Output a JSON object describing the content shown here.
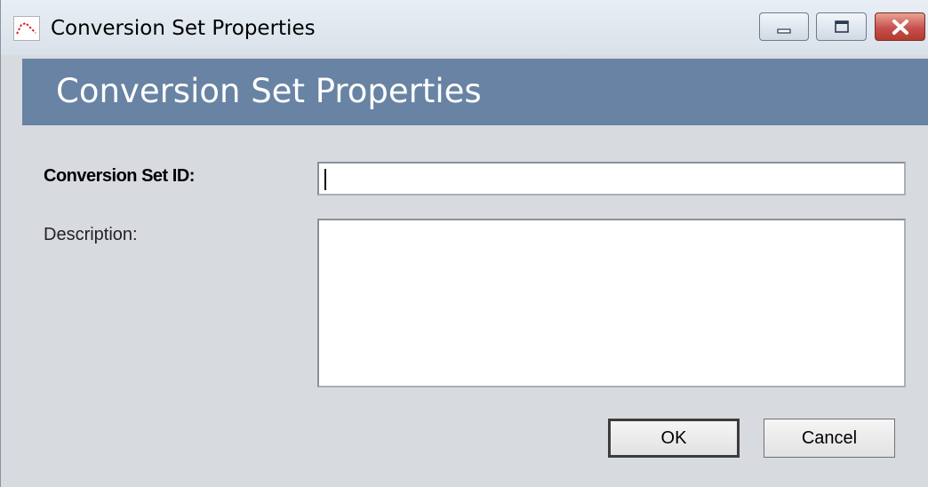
{
  "window": {
    "title": "Conversion Set Properties",
    "controls": {
      "minimize_icon": "minimize-icon",
      "maximize_icon": "maximize-icon",
      "close_icon": "close-icon"
    }
  },
  "header": {
    "title": "Conversion Set Properties",
    "background_color": "#6883a3"
  },
  "form": {
    "conversion_set_id": {
      "label": "Conversion Set ID:",
      "value": ""
    },
    "description": {
      "label": "Description:",
      "value": ""
    }
  },
  "buttons": {
    "ok_label": "OK",
    "cancel_label": "Cancel"
  }
}
